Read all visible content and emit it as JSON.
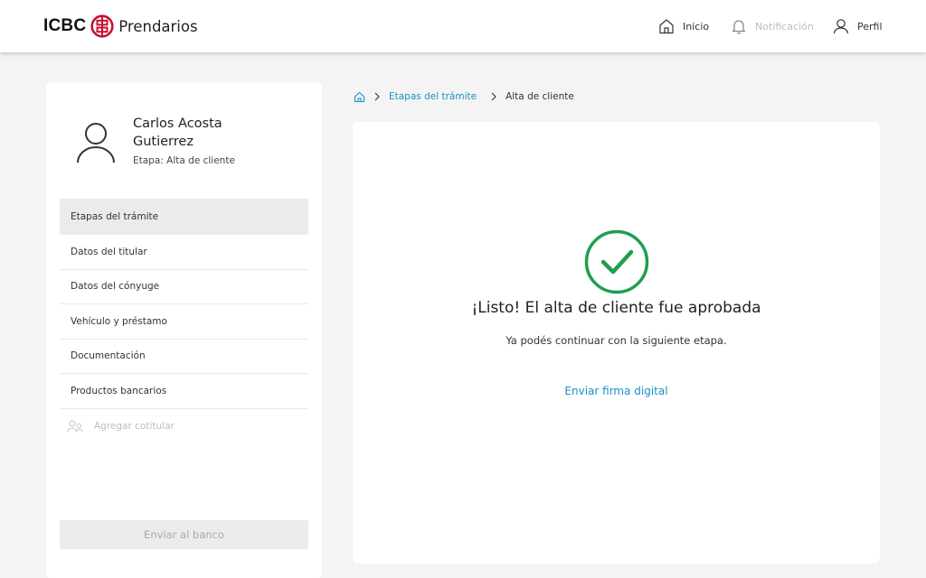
{
  "header": {
    "brand_icbc": "ICBC",
    "brand_name": "Prendarios",
    "nav": {
      "inicio": "Inicio",
      "notificacion": "Notificación",
      "perfil": "Perfil"
    }
  },
  "sidebar": {
    "client_name": "Carlos Acosta Gutierrez",
    "stage": "Etapa: Alta de cliente",
    "items": [
      {
        "label": "Etapas del trámite"
      },
      {
        "label": "Datos del titular"
      },
      {
        "label": "Datos del cónyuge"
      },
      {
        "label": "Vehículo y préstamo"
      },
      {
        "label": "Documentación"
      },
      {
        "label": "Productos bancarios"
      }
    ],
    "add_cotitular": "Agregar cotitular",
    "send_button": "Enviar al banco"
  },
  "breadcrumb": {
    "link": "Etapas del trámite",
    "current": "Alta de cliente"
  },
  "main": {
    "title": "¡Listo! El alta de cliente fue aprobada",
    "subtitle": "Ya podés continuar con la siguiente etapa.",
    "link": "Enviar firma digital"
  },
  "colors": {
    "brand_red": "#c8102e",
    "success_green": "#1e9e4f",
    "link_blue": "#1a8fc9"
  }
}
